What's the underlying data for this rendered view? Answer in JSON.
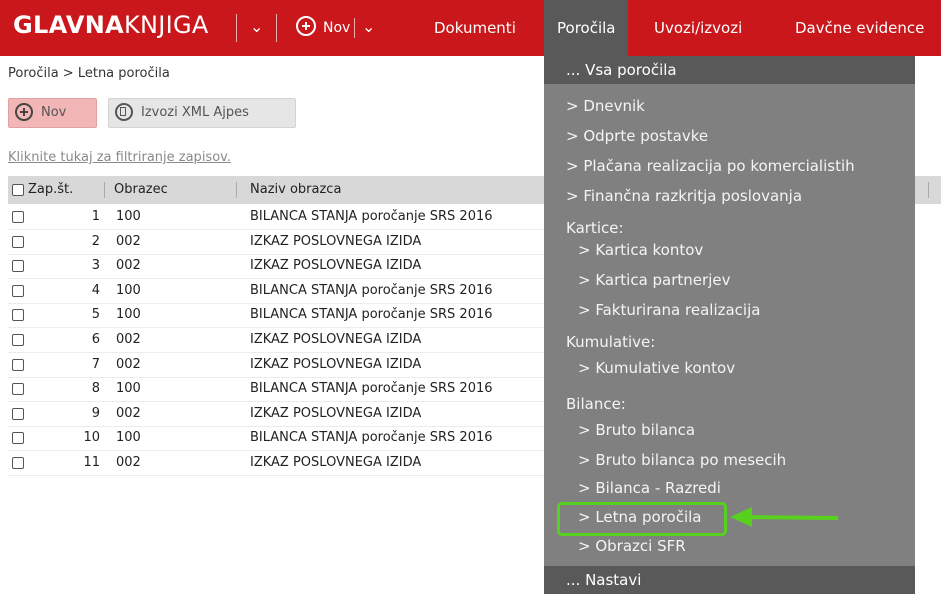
{
  "topbar": {
    "logo_bold": "GLAVNA",
    "logo_thin": "KNJIGA",
    "nov_label": "Nov",
    "nav": [
      "Dokumenti",
      "Poročila",
      "Uvozi/izvozi",
      "Davčne evidence"
    ]
  },
  "breadcrumb": "Poročila > Letna poročila",
  "toolbar": {
    "nov_label": "Nov",
    "xml_label": "Izvozi XML Ajpes"
  },
  "filter_link": "Kliknite tukaj za filtriranje zapisov.",
  "table": {
    "headers": [
      "Zap.št.",
      "Obrazec",
      "Naziv obrazca"
    ],
    "rows": [
      {
        "n": "1",
        "code": "100",
        "name": "BILANCA STANJA poročanje SRS 2016"
      },
      {
        "n": "2",
        "code": "002",
        "name": "IZKAZ POSLOVNEGA IZIDA"
      },
      {
        "n": "3",
        "code": "002",
        "name": "IZKAZ POSLOVNEGA IZIDA"
      },
      {
        "n": "4",
        "code": "100",
        "name": "BILANCA STANJA poročanje SRS 2016"
      },
      {
        "n": "5",
        "code": "100",
        "name": "BILANCA STANJA poročanje SRS 2016"
      },
      {
        "n": "6",
        "code": "002",
        "name": "IZKAZ POSLOVNEGA IZIDA"
      },
      {
        "n": "7",
        "code": "002",
        "name": "IZKAZ POSLOVNEGA IZIDA"
      },
      {
        "n": "8",
        "code": "100",
        "name": "BILANCA STANJA poročanje SRS 2016"
      },
      {
        "n": "9",
        "code": "002",
        "name": "IZKAZ POSLOVNEGA IZIDA"
      },
      {
        "n": "10",
        "code": "100",
        "name": "BILANCA STANJA poročanje SRS 2016"
      },
      {
        "n": "11",
        "code": "002",
        "name": "IZKAZ POSLOVNEGA IZIDA"
      }
    ]
  },
  "menu": {
    "all": "... Vsa poročila",
    "items": [
      "> Dnevnik",
      "> Odprte postavke",
      "> Plačana realizacija po komercialistih",
      "> Finančna razkritja poslovanja",
      "Kartice:",
      "> Kartica kontov",
      "> Kartica partnerjev",
      "> Fakturirana realizacija",
      "Kumulative:",
      "> Kumulative kontov",
      "Bilance:",
      "> Bruto bilanca",
      "> Bruto bilanca po mesecih",
      "> Bilanca - Razredi",
      "> Letna poročila",
      "> Obrazci SFR"
    ],
    "more": "... Nastavi"
  },
  "colors": {
    "brand": "#c9171c",
    "menu_bg": "#808080",
    "menu_dark": "#595959",
    "highlight": "#58d01e"
  }
}
